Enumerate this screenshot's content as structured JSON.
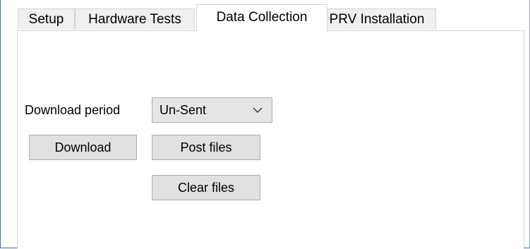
{
  "tabs": [
    {
      "label": "Setup"
    },
    {
      "label": "Hardware Tests"
    },
    {
      "label": "Data Collection"
    },
    {
      "label": "PRV Installation"
    }
  ],
  "active_tab": "Data Collection",
  "data_collection": {
    "download_period_label": "Download period",
    "download_period_value": "Un-Sent",
    "download_button": "Download",
    "post_files_button": "Post files",
    "clear_files_button": "Clear files"
  },
  "icons": {
    "dropdown": "chevron-down-icon"
  }
}
